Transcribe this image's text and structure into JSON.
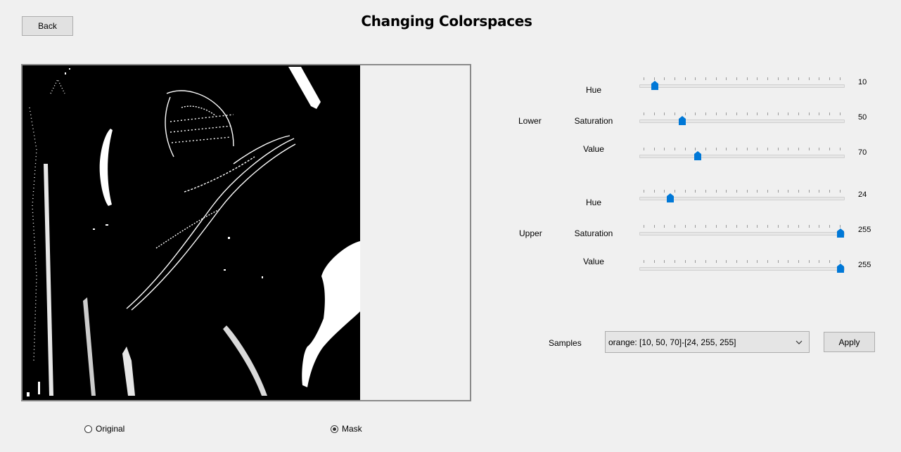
{
  "window": {
    "title": "Changing Colorspaces",
    "back_label": "Back"
  },
  "image": {
    "mode": "mask",
    "colors": {
      "mask_bg": "#000000",
      "mask_fg": "#ffffff",
      "frame": "#8a8a8a"
    }
  },
  "controls": {
    "lower_label": "Lower",
    "upper_label": "Upper",
    "lower": {
      "hue": {
        "label": "Hue",
        "value": "10",
        "max": 179
      },
      "saturation": {
        "label": "Saturation",
        "value": "50",
        "max": 255
      },
      "value": {
        "label": "Value",
        "value": "70",
        "max": 255
      }
    },
    "upper": {
      "hue": {
        "label": "Hue",
        "value": "24",
        "max": 179
      },
      "saturation": {
        "label": "Saturation",
        "value": "255",
        "max": 255
      },
      "value": {
        "label": "Value",
        "value": "255",
        "max": 255
      }
    },
    "accent_color": "#0078d7"
  },
  "samples": {
    "label": "Samples",
    "selected": "orange: [10, 50, 70]-[24, 255, 255]",
    "apply_label": "Apply"
  },
  "view_mode": {
    "original_label": "Original",
    "mask_label": "Mask",
    "selected": "mask"
  }
}
